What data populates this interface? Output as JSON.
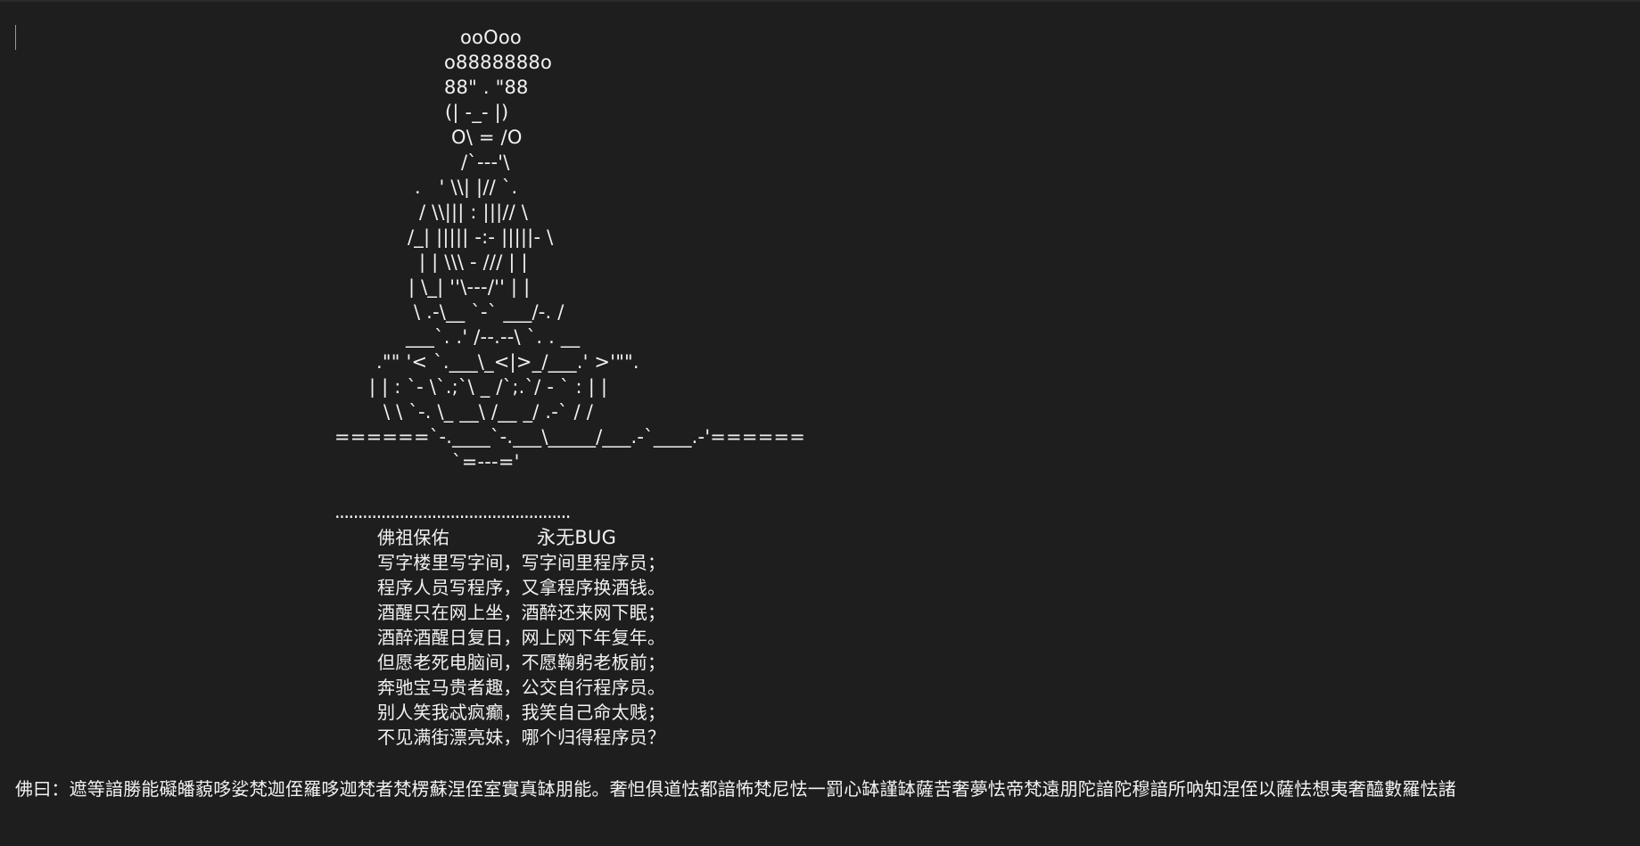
{
  "document": {
    "ascii_art": [
      "ooOoo",
      "o8888888o",
      "88\" . \"88",
      "(| -_- |)",
      "O\\ = /O",
      "/`---'\\",
      ".   ' \\\\| |// `.",
      "/ \\\\||| : |||// \\",
      "/_| ||||| -:- |||||- \\",
      "| | \\\\\\ - /// | |",
      "| \\_| ''\\---/'' | |",
      "\\ .-\\__ `-` ___/-. /",
      "___`. .' /--.--\\ `. . __",
      ".\"\" '< `.___\\_<|>_/___.' >'\"\".",
      "| | : `- \\`.;`\\ _ /`;.`/ - ` : | |",
      "\\ \\ `-. \\_ __\\ /__ _/ .-` / /",
      "======`-.____`-.___\\_____/___.-`____.-'======",
      "`=---='"
    ],
    "separator": "...................................................",
    "blessing": {
      "left": "佛祖保佑",
      "right": "永无BUG"
    },
    "poem": [
      "写字楼里写字间，写字间里程序员；",
      "程序人员写程序，又拿程序换酒钱。",
      "酒醒只在网上坐，酒醉还来网下眠；",
      "酒醉酒醒日复日，网上网下年复年。",
      "但愿老死电脑间，不愿鞠躬老板前；",
      "奔驰宝马贵者趣，公交自行程序员。",
      "别人笑我忒疯癫，我笑自己命太贱；",
      "不见满街漂亮妹，哪个归得程序员？"
    ],
    "footer": "佛曰：遮等諳勝能礙皤藐哆娑梵迦侄羅哆迦梵者梵楞蘇涅侄室實真缽朋能。奢怛俱道怯都諳怖梵尼怯一罰心缽謹缽薩苦奢夢怯帝梵遠朋陀諳陀穆諳所吶知涅侄以薩怯想夷奢醯數羅怯諸"
  }
}
